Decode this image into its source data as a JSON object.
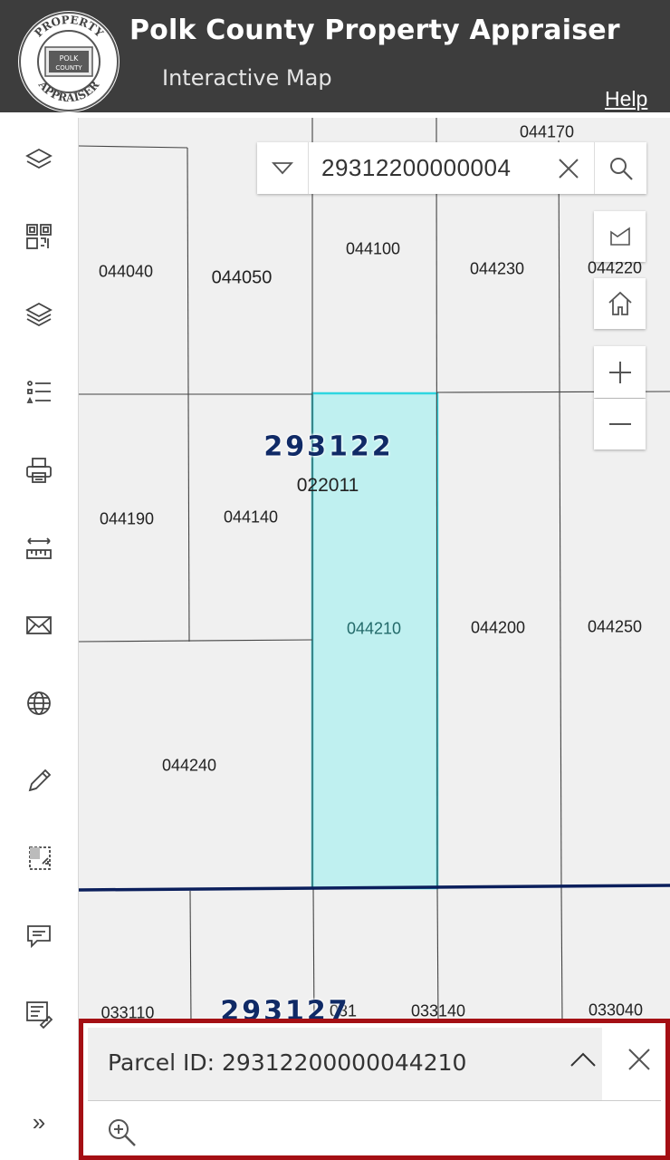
{
  "header": {
    "title": "Polk County Property Appraiser",
    "subtitle": "Interactive Map",
    "help": "Help",
    "logo": {
      "top_text": "PROPERTY",
      "bottom_text": "APPRAISER",
      "center_line1": "POLK",
      "center_line2": "COUNTY"
    },
    "background": "#3d3d3d"
  },
  "sidebar": {
    "items": [
      {
        "icon": "layers-icon"
      },
      {
        "icon": "qr-grid-icon"
      },
      {
        "icon": "layers-stack-icon"
      },
      {
        "icon": "legend-list-icon"
      },
      {
        "icon": "print-icon"
      },
      {
        "icon": "measure-icon"
      },
      {
        "icon": "email-icon"
      },
      {
        "icon": "globe-icon"
      },
      {
        "icon": "pencil-icon"
      },
      {
        "icon": "select-area-icon"
      },
      {
        "icon": "comment-icon"
      },
      {
        "icon": "report-tools-icon"
      }
    ],
    "expand_label": "»"
  },
  "search": {
    "value": "29312200000004"
  },
  "map": {
    "section_labels": [
      "293122",
      "293127"
    ],
    "center_label": "022011",
    "parcel_labels": [
      "044170",
      "044040",
      "044050",
      "044100",
      "044230",
      "044220",
      "044190",
      "044140",
      "044210",
      "044200",
      "044250",
      "044240",
      "033110",
      "031",
      "033140",
      "033040"
    ],
    "highlight_color": "#bff0f0",
    "highlight_border": "#2fd6e0",
    "section_line_color": "#0b1f5c"
  },
  "popup": {
    "title": "Parcel ID: 29312200000044210",
    "border_color": "#a40f14"
  }
}
